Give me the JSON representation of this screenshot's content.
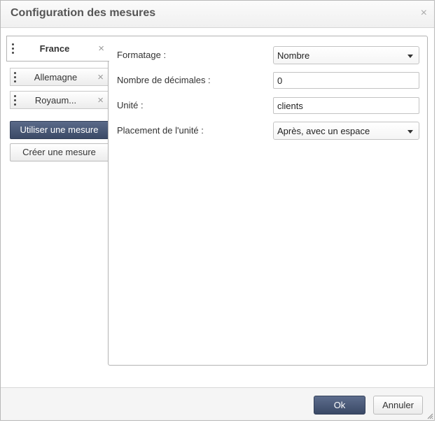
{
  "dialog": {
    "title": "Configuration des mesures",
    "close_glyph": "×"
  },
  "measures": [
    {
      "label": "France",
      "remove_glyph": "×",
      "active": true
    },
    {
      "label": "Allemagne",
      "remove_glyph": "×",
      "active": false
    },
    {
      "label": "Royaum...",
      "remove_glyph": "×",
      "active": false
    }
  ],
  "left_buttons": {
    "use": "Utiliser une mesure",
    "create": "Créer une mesure"
  },
  "form": {
    "formatting": {
      "label": "Formatage :",
      "value": "Nombre"
    },
    "decimals": {
      "label": "Nombre de décimales :",
      "value": "0"
    },
    "unit": {
      "label": "Unité :",
      "value": "clients"
    },
    "unit_placement": {
      "label": "Placement de l'unité :",
      "value": "Après, avec un espace"
    }
  },
  "footer": {
    "ok": "Ok",
    "cancel": "Annuler"
  },
  "colors": {
    "primary_button": "#3b4a66",
    "border": "#b3b3b3"
  }
}
